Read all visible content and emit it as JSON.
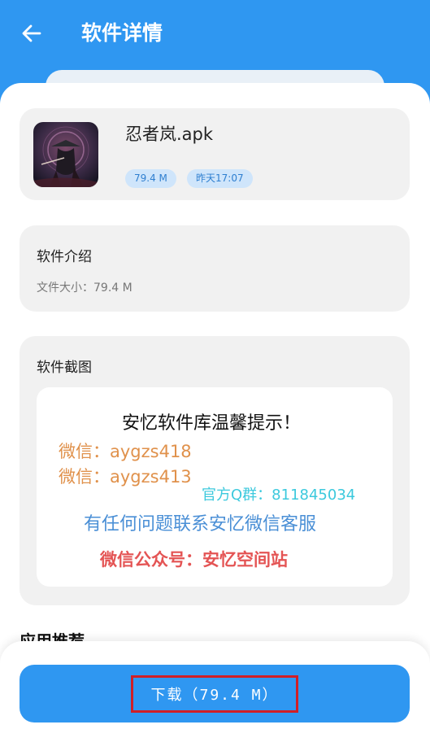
{
  "header": {
    "title": "软件详情"
  },
  "app": {
    "name": "忍者岚.apk",
    "size_badge": "79.4 M",
    "time_badge": "昨天17:07"
  },
  "intro": {
    "title": "软件介绍",
    "file_size_line": "文件大小：79.4 M"
  },
  "screenshots": {
    "title": "软件截图",
    "image_text": {
      "headline": "安忆软件库温馨提示！",
      "wechat_1": "微信：aygzs418",
      "wechat_2": "微信：aygzs413",
      "qq_group": "官方Q群：811845034",
      "contact": "有任何问题联系安忆微信客服",
      "public_account": "微信公众号：安忆空间站"
    }
  },
  "recommend": {
    "title": "应用推荐"
  },
  "footer": {
    "download_label": "下载（79.4 M）"
  },
  "colors": {
    "primary": "#2f97f1",
    "card": "#f1f1f1",
    "badge_bg": "#cfe5fb",
    "highlight_frame": "#d01f27"
  }
}
